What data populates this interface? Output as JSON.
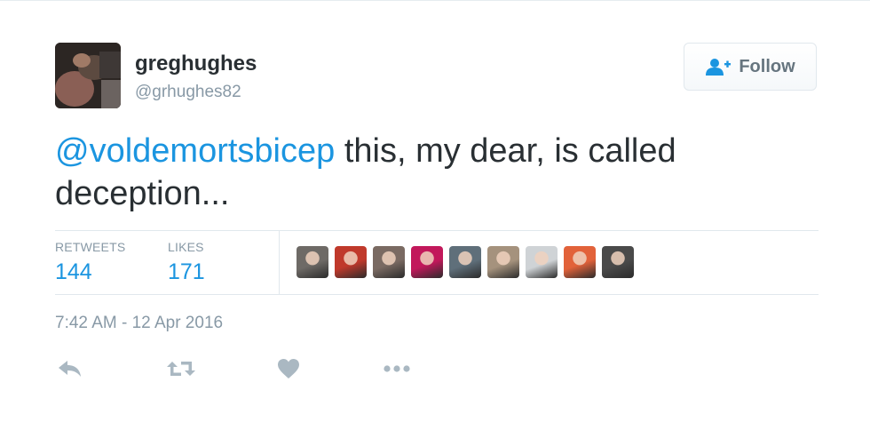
{
  "user": {
    "display_name": "greghughes",
    "handle": "@grhughes82",
    "avatar_icon": "profile-photo"
  },
  "follow_button": {
    "label": "Follow",
    "icon": "follow-user-icon"
  },
  "tweet": {
    "mention": "@voldemortsbicep",
    "text": " this, my dear, is called deception..."
  },
  "stats": {
    "retweets_label": "RETWEETS",
    "retweets_count": "144",
    "likes_label": "LIKES",
    "likes_count": "171"
  },
  "likers": [
    {
      "avatar_color": "#6e6a66"
    },
    {
      "avatar_color": "#c0392b"
    },
    {
      "avatar_color": "#7a6a62"
    },
    {
      "avatar_color": "#c2185b"
    },
    {
      "avatar_color": "#5f6f7a"
    },
    {
      "avatar_color": "#a5927d"
    },
    {
      "avatar_color": "#cfd3d6"
    },
    {
      "avatar_color": "#e2623a"
    },
    {
      "avatar_color": "#4a4a4a"
    }
  ],
  "timestamp": "7:42 AM - 12 Apr 2016",
  "actions": [
    "reply-icon",
    "retweet-icon",
    "like-icon",
    "more-icon"
  ],
  "colors": {
    "link_blue": "#1b95e0",
    "muted_gray": "#8899a6",
    "text_dark": "#292f33",
    "action_gray": "#aab8c2"
  }
}
